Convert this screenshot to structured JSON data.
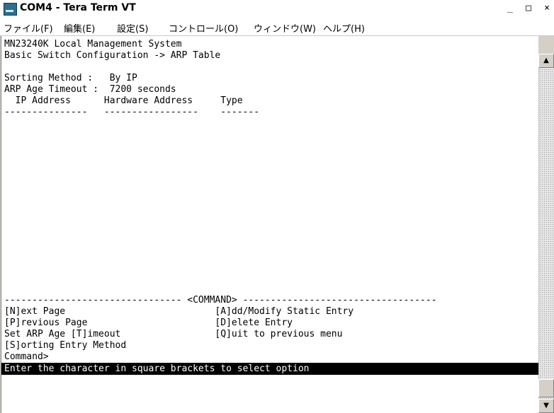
{
  "window": {
    "title": "COM4 - Tera Term VT",
    "minimize": "_",
    "maximize": "□",
    "close": "×"
  },
  "menu": [
    "ファイル(F)",
    "編集(E)",
    "設定(S)",
    "コントロール(O)",
    "ウィンドウ(W)",
    "ヘルプ(H)"
  ],
  "terminal": {
    "lines": [
      "MN23240K Local Management System",
      "Basic Switch Configuration -> ARP Table",
      "",
      "Sorting Method :   By IP",
      "ARP Age Timeout :  7200 seconds",
      "  IP Address      Hardware Address     Type",
      "---------------   -----------------    -------",
      "",
      "",
      "",
      "",
      "",
      "",
      "",
      "",
      "",
      "",
      "",
      "",
      "-------------------------------- <COMMAND> -----------------------------------",
      "[N]ext Page                           [A]dd/Modify Static Entry",
      "[P]revious Page                       [D]elete Entry",
      "Set ARP Age [T]imeout                 [Q]uit to previous menu",
      "[S]orting Entry Method",
      "Command>"
    ],
    "status": "Enter the character in square brackets to select option"
  },
  "scrollbar": {
    "up_arrow": "▲",
    "down_arrow": "▼"
  }
}
